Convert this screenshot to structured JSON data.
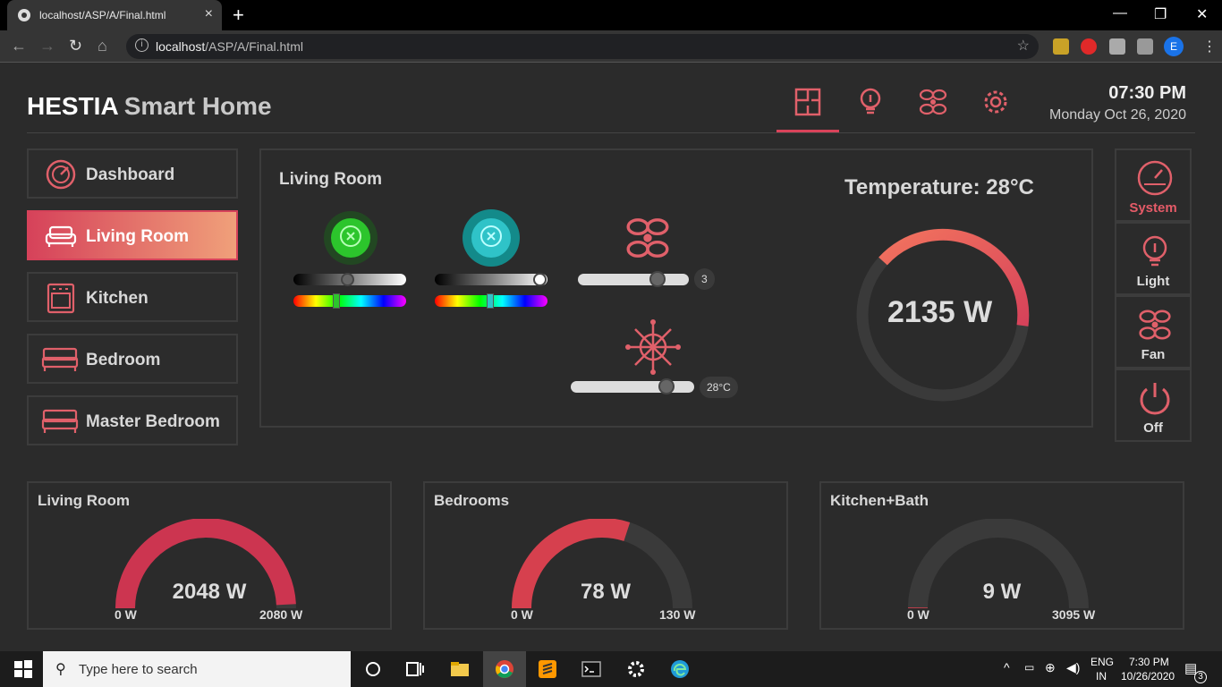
{
  "browser": {
    "tab_title": "localhost/ASP/A/Final.html",
    "url_host": "localhost",
    "url_path": "/ASP/A/Final.html",
    "profile_initial": "E"
  },
  "app": {
    "brand": "HESTIA",
    "brand_sub": "Smart Home",
    "time": "07:30 PM",
    "date": "Monday Oct 26, 2020",
    "topnav": [
      "floorplan-icon",
      "bulb-icon",
      "fan-icon",
      "settings-icon"
    ],
    "accent": "#d6425a"
  },
  "sidebar": {
    "items": [
      {
        "label": "Dashboard",
        "icon": "dashboard-icon"
      },
      {
        "label": "Living Room",
        "icon": "sofa-icon",
        "active": true
      },
      {
        "label": "Kitchen",
        "icon": "oven-icon"
      },
      {
        "label": "Bedroom",
        "icon": "bed-icon"
      },
      {
        "label": "Master Bedroom",
        "icon": "bed-icon"
      }
    ]
  },
  "room_panel": {
    "title": "Living Room",
    "fan_speed": "3",
    "ac_temp": "28°C",
    "temperature_label": "Temperature: 28°C",
    "total_watt": "2135 W"
  },
  "right_controls": [
    {
      "label": "System",
      "icon": "gauge-icon"
    },
    {
      "label": "Light",
      "icon": "bulb-icon"
    },
    {
      "label": "Fan",
      "icon": "fan-icon"
    },
    {
      "label": "Off",
      "icon": "power-icon"
    }
  ],
  "cards": [
    {
      "title": "Living Room",
      "value": "2048 W",
      "min": "0 W",
      "max": "2080 W",
      "fraction": 0.985
    },
    {
      "title": "Bedrooms",
      "value": "78 W",
      "min": "0 W",
      "max": "130 W",
      "fraction": 0.6
    },
    {
      "title": "Kitchen+Bath",
      "value": "9 W",
      "min": "0 W",
      "max": "3095 W",
      "fraction": 0.003
    }
  ],
  "taskbar": {
    "search_placeholder": "Type here to search",
    "lang": "ENG",
    "region": "IN",
    "time": "7:30 PM",
    "date": "10/26/2020",
    "notifications": "3"
  }
}
